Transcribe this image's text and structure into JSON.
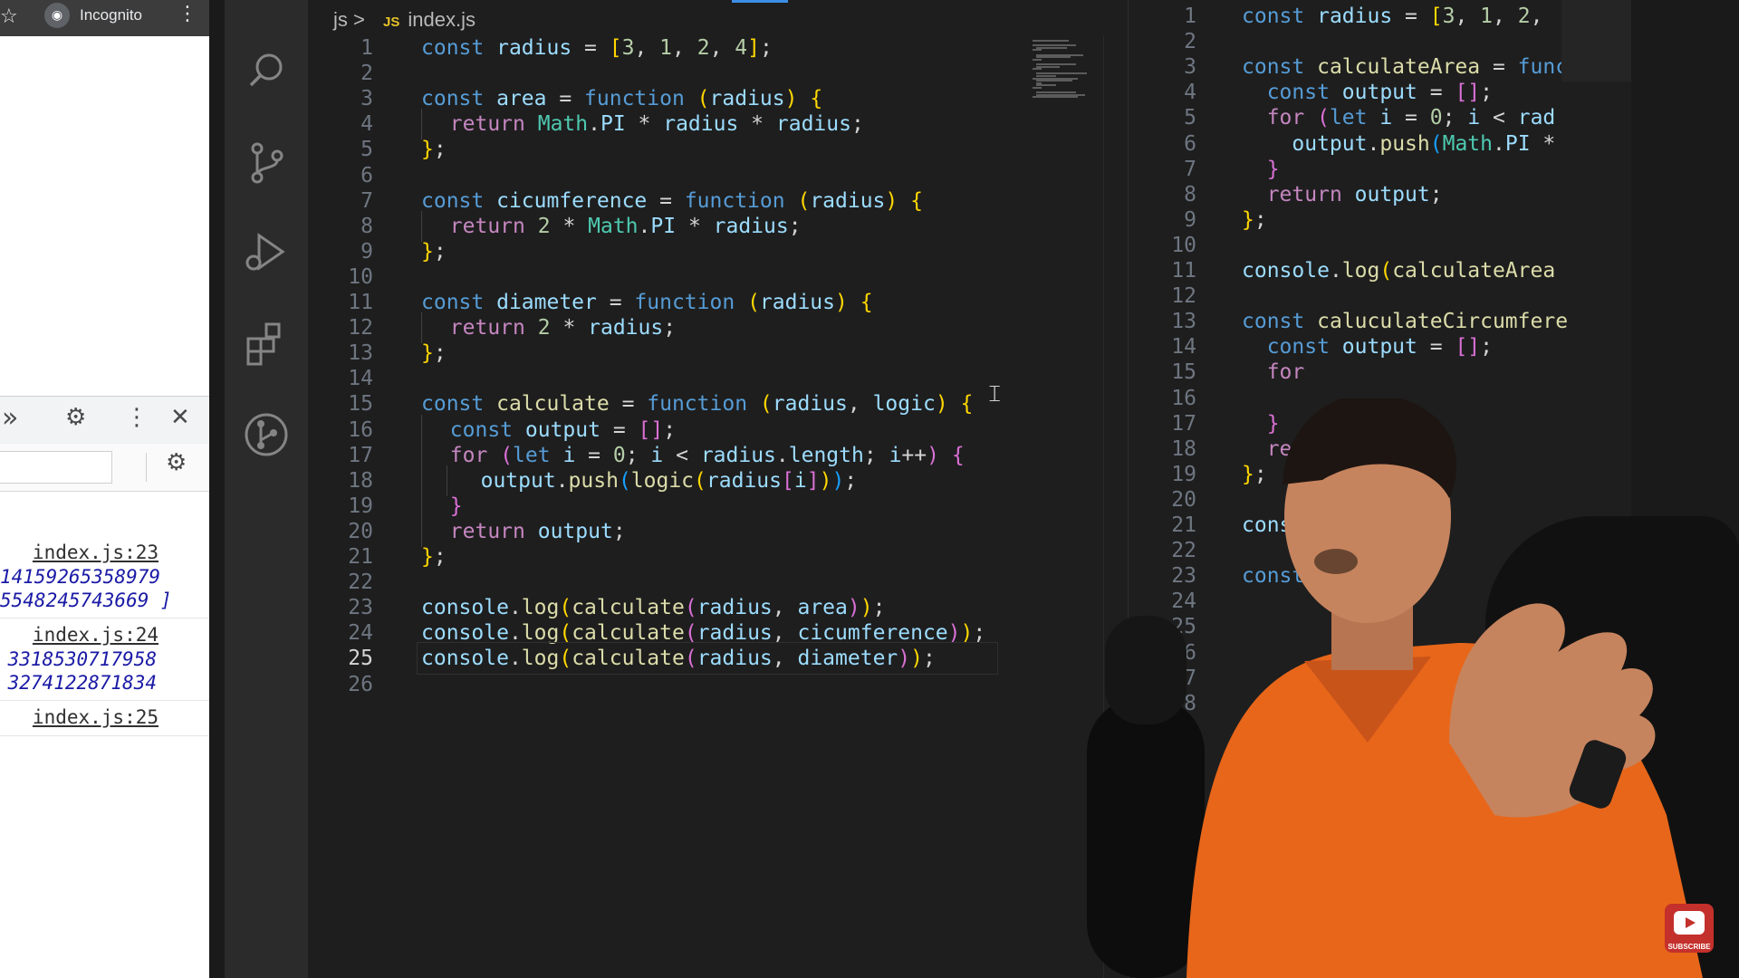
{
  "browser": {
    "star_glyph": "☆",
    "incognito_label": "Incognito",
    "menu_glyph": "⋮"
  },
  "devtools": {
    "more_glyph": "»",
    "settings_glyph": "⚙",
    "menu_glyph": "⋮",
    "close_glyph": "✕",
    "console_entries": [
      {
        "source": "index.js:23",
        "lines": [
          "14159265358979",
          "5548245743669 ]"
        ]
      },
      {
        "source": "index.js:24",
        "lines": [
          "3318530717958",
          "3274122871834"
        ]
      },
      {
        "source": "index.js:25",
        "lines": []
      }
    ]
  },
  "editor": {
    "breadcrumb": {
      "folder": "js",
      "separator": ">",
      "badge": "JS",
      "file": "index.js"
    },
    "current_line": 25,
    "lines": [
      {
        "n": "1",
        "indent": 0,
        "tokens": [
          [
            "kw",
            "const "
          ],
          [
            "var",
            "radius"
          ],
          [
            "plain",
            " = "
          ],
          [
            "p1",
            "["
          ],
          [
            "num",
            "3"
          ],
          [
            "plain",
            ", "
          ],
          [
            "num",
            "1"
          ],
          [
            "plain",
            ", "
          ],
          [
            "num",
            "2"
          ],
          [
            "plain",
            ", "
          ],
          [
            "num",
            "4"
          ],
          [
            "p1",
            "]"
          ],
          [
            "plain",
            ";"
          ]
        ]
      },
      {
        "n": "2",
        "indent": 0,
        "tokens": []
      },
      {
        "n": "3",
        "indent": 0,
        "tokens": [
          [
            "kw",
            "const "
          ],
          [
            "var",
            "area"
          ],
          [
            "plain",
            " = "
          ],
          [
            "kw",
            "function"
          ],
          [
            "plain",
            " "
          ],
          [
            "p1",
            "("
          ],
          [
            "var",
            "radius"
          ],
          [
            "p1",
            ")"
          ],
          [
            "plain",
            " "
          ],
          [
            "p1",
            "{"
          ]
        ]
      },
      {
        "n": "4",
        "indent": 1,
        "tokens": [
          [
            "ctl",
            "return "
          ],
          [
            "cls",
            "Math"
          ],
          [
            "plain",
            "."
          ],
          [
            "var",
            "PI"
          ],
          [
            "plain",
            " * "
          ],
          [
            "var",
            "radius"
          ],
          [
            "plain",
            " * "
          ],
          [
            "var",
            "radius"
          ],
          [
            "plain",
            ";"
          ]
        ]
      },
      {
        "n": "5",
        "indent": 0,
        "tokens": [
          [
            "p1",
            "}"
          ],
          [
            "plain",
            ";"
          ]
        ]
      },
      {
        "n": "6",
        "indent": 0,
        "tokens": []
      },
      {
        "n": "7",
        "indent": 0,
        "tokens": [
          [
            "kw",
            "const "
          ],
          [
            "var",
            "cicumference"
          ],
          [
            "plain",
            " = "
          ],
          [
            "kw",
            "function"
          ],
          [
            "plain",
            " "
          ],
          [
            "p1",
            "("
          ],
          [
            "var",
            "radius"
          ],
          [
            "p1",
            ")"
          ],
          [
            "plain",
            " "
          ],
          [
            "p1",
            "{"
          ]
        ]
      },
      {
        "n": "8",
        "indent": 1,
        "tokens": [
          [
            "ctl",
            "return "
          ],
          [
            "num",
            "2"
          ],
          [
            "plain",
            " * "
          ],
          [
            "cls",
            "Math"
          ],
          [
            "plain",
            "."
          ],
          [
            "var",
            "PI"
          ],
          [
            "plain",
            " * "
          ],
          [
            "var",
            "radius"
          ],
          [
            "plain",
            ";"
          ]
        ]
      },
      {
        "n": "9",
        "indent": 0,
        "tokens": [
          [
            "p1",
            "}"
          ],
          [
            "plain",
            ";"
          ]
        ]
      },
      {
        "n": "10",
        "indent": 0,
        "tokens": []
      },
      {
        "n": "11",
        "indent": 0,
        "tokens": [
          [
            "kw",
            "const "
          ],
          [
            "var",
            "diameter"
          ],
          [
            "plain",
            " = "
          ],
          [
            "kw",
            "function"
          ],
          [
            "plain",
            " "
          ],
          [
            "p1",
            "("
          ],
          [
            "var",
            "radius"
          ],
          [
            "p1",
            ")"
          ],
          [
            "plain",
            " "
          ],
          [
            "p1",
            "{"
          ]
        ]
      },
      {
        "n": "12",
        "indent": 1,
        "tokens": [
          [
            "ctl",
            "return "
          ],
          [
            "num",
            "2"
          ],
          [
            "plain",
            " * "
          ],
          [
            "var",
            "radius"
          ],
          [
            "plain",
            ";"
          ]
        ]
      },
      {
        "n": "13",
        "indent": 0,
        "tokens": [
          [
            "p1",
            "}"
          ],
          [
            "plain",
            ";"
          ]
        ]
      },
      {
        "n": "14",
        "indent": 0,
        "tokens": []
      },
      {
        "n": "15",
        "indent": 0,
        "tokens": [
          [
            "kw",
            "const "
          ],
          [
            "fn",
            "calculate"
          ],
          [
            "plain",
            " = "
          ],
          [
            "kw",
            "function"
          ],
          [
            "plain",
            " "
          ],
          [
            "p1",
            "("
          ],
          [
            "var",
            "radius"
          ],
          [
            "plain",
            ", "
          ],
          [
            "var",
            "logic"
          ],
          [
            "p1",
            ")"
          ],
          [
            "plain",
            " "
          ],
          [
            "p1",
            "{"
          ]
        ]
      },
      {
        "n": "16",
        "indent": 1,
        "tokens": [
          [
            "kw",
            "const "
          ],
          [
            "var",
            "output"
          ],
          [
            "plain",
            " = "
          ],
          [
            "p2",
            "[]"
          ],
          [
            "plain",
            ";"
          ]
        ]
      },
      {
        "n": "17",
        "indent": 1,
        "tokens": [
          [
            "ctl",
            "for "
          ],
          [
            "p2",
            "("
          ],
          [
            "kw",
            "let "
          ],
          [
            "var",
            "i"
          ],
          [
            "plain",
            " = "
          ],
          [
            "num",
            "0"
          ],
          [
            "plain",
            "; "
          ],
          [
            "var",
            "i"
          ],
          [
            "plain",
            " < "
          ],
          [
            "var",
            "radius"
          ],
          [
            "plain",
            "."
          ],
          [
            "var",
            "length"
          ],
          [
            "plain",
            "; "
          ],
          [
            "var",
            "i"
          ],
          [
            "plain",
            "++"
          ],
          [
            "p2",
            ")"
          ],
          [
            "plain",
            " "
          ],
          [
            "p2",
            "{"
          ]
        ]
      },
      {
        "n": "18",
        "indent": 2,
        "tokens": [
          [
            "var",
            "output"
          ],
          [
            "plain",
            "."
          ],
          [
            "fn",
            "push"
          ],
          [
            "p3",
            "("
          ],
          [
            "fn",
            "logic"
          ],
          [
            "p1",
            "("
          ],
          [
            "var",
            "radius"
          ],
          [
            "p2",
            "["
          ],
          [
            "var",
            "i"
          ],
          [
            "p2",
            "]"
          ],
          [
            "p1",
            ")"
          ],
          [
            "p3",
            ")"
          ],
          [
            "plain",
            ";"
          ]
        ]
      },
      {
        "n": "19",
        "indent": 1,
        "tokens": [
          [
            "p2",
            "}"
          ]
        ]
      },
      {
        "n": "20",
        "indent": 1,
        "tokens": [
          [
            "ctl",
            "return "
          ],
          [
            "var",
            "output"
          ],
          [
            "plain",
            ";"
          ]
        ]
      },
      {
        "n": "21",
        "indent": 0,
        "tokens": [
          [
            "p1",
            "}"
          ],
          [
            "plain",
            ";"
          ]
        ]
      },
      {
        "n": "22",
        "indent": 0,
        "tokens": []
      },
      {
        "n": "23",
        "indent": 0,
        "tokens": [
          [
            "var",
            "console"
          ],
          [
            "plain",
            "."
          ],
          [
            "fn",
            "log"
          ],
          [
            "p1",
            "("
          ],
          [
            "fn",
            "calculate"
          ],
          [
            "p2",
            "("
          ],
          [
            "var",
            "radius"
          ],
          [
            "plain",
            ", "
          ],
          [
            "var",
            "area"
          ],
          [
            "p2",
            ")"
          ],
          [
            "p1",
            ")"
          ],
          [
            "plain",
            ";"
          ]
        ]
      },
      {
        "n": "24",
        "indent": 0,
        "tokens": [
          [
            "var",
            "console"
          ],
          [
            "plain",
            "."
          ],
          [
            "fn",
            "log"
          ],
          [
            "p1",
            "("
          ],
          [
            "fn",
            "calculate"
          ],
          [
            "p2",
            "("
          ],
          [
            "var",
            "radius"
          ],
          [
            "plain",
            ", "
          ],
          [
            "var",
            "cicumference"
          ],
          [
            "p2",
            ")"
          ],
          [
            "p1",
            ")"
          ],
          [
            "plain",
            ";"
          ]
        ]
      },
      {
        "n": "25",
        "indent": 0,
        "tokens": [
          [
            "var",
            "console"
          ],
          [
            "plain",
            "."
          ],
          [
            "fn",
            "log"
          ],
          [
            "p1",
            "("
          ],
          [
            "fn",
            "calculate"
          ],
          [
            "p2",
            "("
          ],
          [
            "var",
            "radius"
          ],
          [
            "plain",
            ", "
          ],
          [
            "var",
            "diameter"
          ],
          [
            "p2",
            ")"
          ],
          [
            "p1",
            ")"
          ],
          [
            "plain",
            ";"
          ]
        ]
      },
      {
        "n": "26",
        "indent": 0,
        "tokens": []
      }
    ]
  },
  "split": {
    "lines": [
      {
        "n": "1",
        "tokens": [
          [
            "kw",
            "const "
          ],
          [
            "var",
            "radius"
          ],
          [
            "plain",
            " = "
          ],
          [
            "p1",
            "["
          ],
          [
            "num",
            "3"
          ],
          [
            "plain",
            ", "
          ],
          [
            "num",
            "1"
          ],
          [
            "plain",
            ", "
          ],
          [
            "num",
            "2"
          ],
          [
            "plain",
            ", "
          ]
        ]
      },
      {
        "n": "2",
        "tokens": []
      },
      {
        "n": "3",
        "tokens": [
          [
            "kw",
            "const "
          ],
          [
            "fn",
            "calculateArea"
          ],
          [
            "plain",
            " = "
          ],
          [
            "kw",
            "func"
          ]
        ]
      },
      {
        "n": "4",
        "tokens": [
          [
            "plain",
            "  "
          ],
          [
            "kw",
            "const "
          ],
          [
            "var",
            "output"
          ],
          [
            "plain",
            " = "
          ],
          [
            "p2",
            "[]"
          ],
          [
            "plain",
            ";"
          ]
        ]
      },
      {
        "n": "5",
        "tokens": [
          [
            "plain",
            "  "
          ],
          [
            "ctl",
            "for "
          ],
          [
            "p2",
            "("
          ],
          [
            "kw",
            "let "
          ],
          [
            "var",
            "i"
          ],
          [
            "plain",
            " = "
          ],
          [
            "num",
            "0"
          ],
          [
            "plain",
            "; "
          ],
          [
            "var",
            "i"
          ],
          [
            "plain",
            " < "
          ],
          [
            "var",
            "rad"
          ]
        ]
      },
      {
        "n": "6",
        "tokens": [
          [
            "plain",
            "    "
          ],
          [
            "var",
            "output"
          ],
          [
            "plain",
            "."
          ],
          [
            "fn",
            "push"
          ],
          [
            "p3",
            "("
          ],
          [
            "cls",
            "Math"
          ],
          [
            "plain",
            "."
          ],
          [
            "var",
            "PI"
          ],
          [
            "plain",
            " *"
          ]
        ]
      },
      {
        "n": "7",
        "tokens": [
          [
            "plain",
            "  "
          ],
          [
            "p2",
            "}"
          ]
        ]
      },
      {
        "n": "8",
        "tokens": [
          [
            "plain",
            "  "
          ],
          [
            "ctl",
            "return "
          ],
          [
            "var",
            "output"
          ],
          [
            "plain",
            ";"
          ]
        ]
      },
      {
        "n": "9",
        "tokens": [
          [
            "p1",
            "}"
          ],
          [
            "plain",
            ";"
          ]
        ]
      },
      {
        "n": "10",
        "tokens": []
      },
      {
        "n": "11",
        "tokens": [
          [
            "var",
            "console"
          ],
          [
            "plain",
            "."
          ],
          [
            "fn",
            "log"
          ],
          [
            "p1",
            "("
          ],
          [
            "fn",
            "calculateArea"
          ]
        ]
      },
      {
        "n": "12",
        "tokens": []
      },
      {
        "n": "13",
        "tokens": [
          [
            "kw",
            "const "
          ],
          [
            "fn",
            "caluculateCircumfere"
          ]
        ]
      },
      {
        "n": "14",
        "tokens": [
          [
            "plain",
            "  "
          ],
          [
            "kw",
            "const "
          ],
          [
            "var",
            "output"
          ],
          [
            "plain",
            " = "
          ],
          [
            "p2",
            "[]"
          ],
          [
            "plain",
            ";"
          ]
        ]
      },
      {
        "n": "15",
        "tokens": [
          [
            "plain",
            "  "
          ],
          [
            "ctl",
            "for"
          ]
        ]
      },
      {
        "n": "16",
        "tokens": []
      },
      {
        "n": "17",
        "tokens": [
          [
            "plain",
            "  "
          ],
          [
            "p2",
            "}"
          ]
        ]
      },
      {
        "n": "18",
        "tokens": [
          [
            "plain",
            "  "
          ],
          [
            "ctl",
            "ret"
          ]
        ]
      },
      {
        "n": "19",
        "tokens": [
          [
            "p1",
            "}"
          ],
          [
            "plain",
            ";"
          ]
        ]
      },
      {
        "n": "20",
        "tokens": []
      },
      {
        "n": "21",
        "tokens": [
          [
            "var",
            "consol"
          ]
        ]
      },
      {
        "n": "22",
        "tokens": []
      },
      {
        "n": "23",
        "tokens": [
          [
            "kw",
            "const"
          ]
        ]
      },
      {
        "n": "24",
        "tokens": []
      },
      {
        "n": "25",
        "tokens": []
      },
      {
        "n": "26",
        "tokens": []
      },
      {
        "n": "27",
        "tokens": []
      },
      {
        "n": "8",
        "tokens": []
      }
    ]
  },
  "youtube": {
    "subscribe_label": "SUBSCRIBE"
  },
  "colors": {
    "editor_bg": "#1e1e1e",
    "activity_bar_bg": "#2b2b2b",
    "shirt_orange": "#e8661a",
    "subscribe_red": "#c4302b"
  }
}
